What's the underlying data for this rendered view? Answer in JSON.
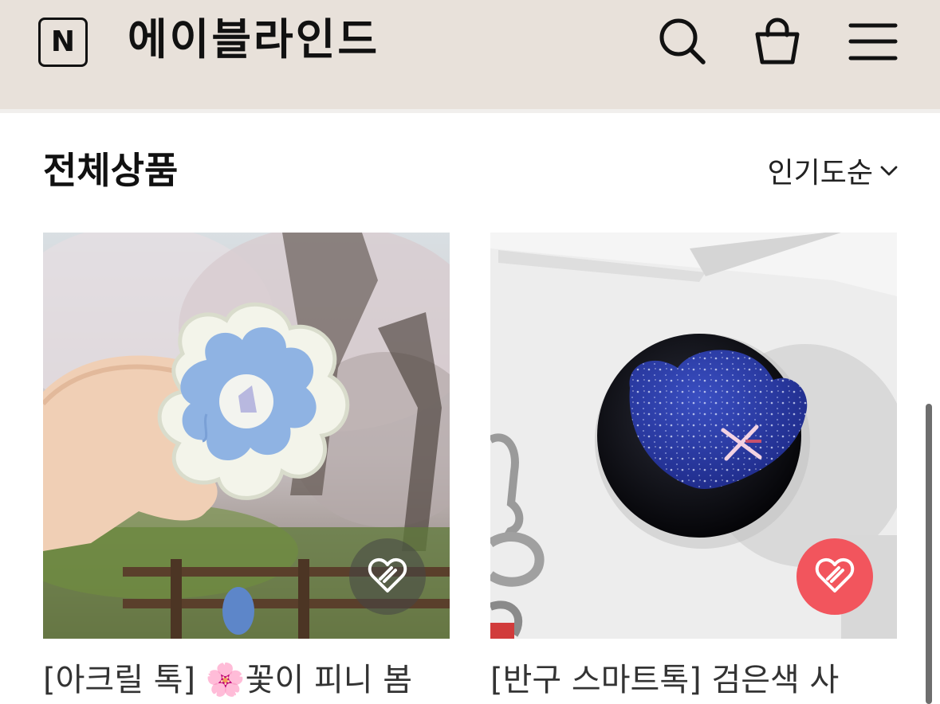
{
  "header": {
    "logo_letter": "N",
    "brand": "에이블라인드",
    "icons": [
      "search-icon",
      "shopping-bag-icon",
      "menu-icon"
    ],
    "background": "#e8e1da"
  },
  "section": {
    "title": "전체상품",
    "sort_label": "인기도순"
  },
  "products": [
    {
      "name": "[아크릴 톡] 🌸꽃이 피니 봄",
      "liked": false
    },
    {
      "name": "[반구 스마트톡] 검은색 사",
      "liked": true
    }
  ],
  "colors": {
    "accent_like": "#f2555d",
    "text": "#111111"
  }
}
